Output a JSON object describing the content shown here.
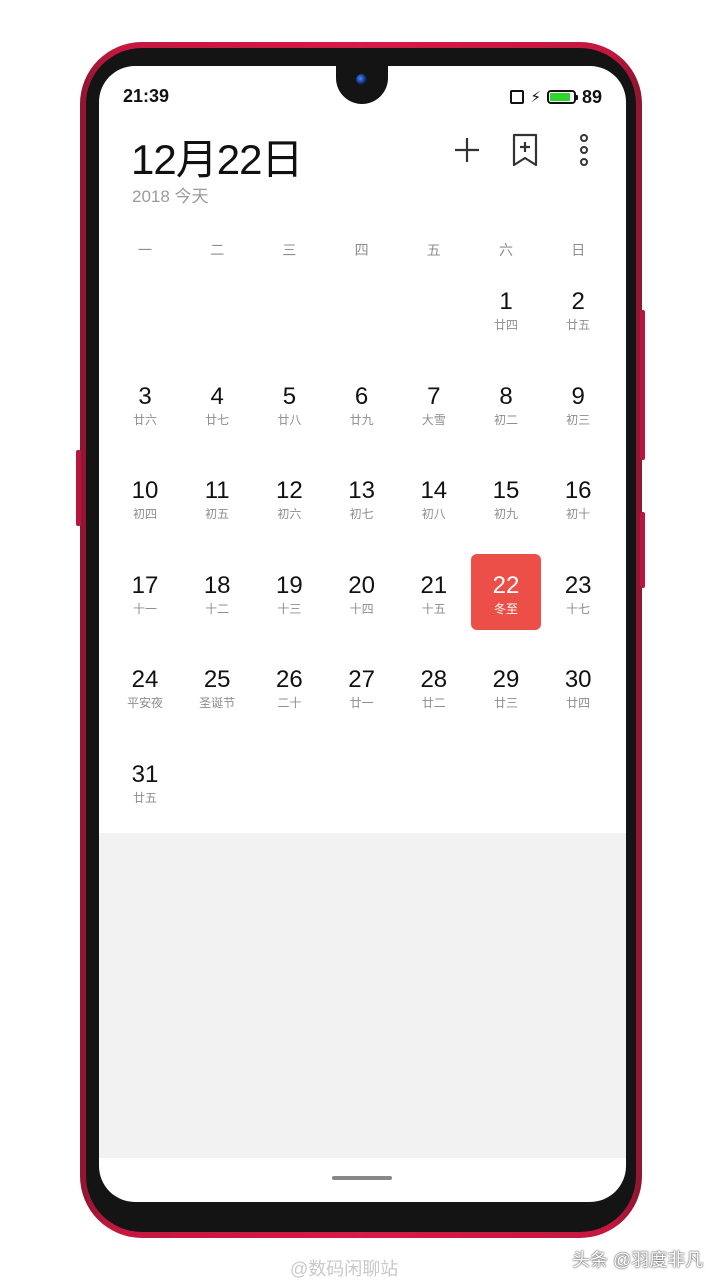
{
  "status_bar": {
    "time": "21:39",
    "battery_percent": "89",
    "battery_level": 0.89,
    "battery_color": "#2fd52f"
  },
  "header": {
    "date_title": "12月22日",
    "subtitle": "2018 今天"
  },
  "icons": {
    "add": "plus-icon",
    "bookmark": "bookmark-add-icon",
    "more": "more-vertical-icon"
  },
  "weekdays": [
    "一",
    "二",
    "三",
    "四",
    "五",
    "六",
    "日"
  ],
  "days": [
    {
      "num": "1",
      "lunar": "廿四"
    },
    {
      "num": "2",
      "lunar": "廿五"
    },
    {
      "num": "3",
      "lunar": "廿六"
    },
    {
      "num": "4",
      "lunar": "廿七"
    },
    {
      "num": "5",
      "lunar": "廿八"
    },
    {
      "num": "6",
      "lunar": "廿九"
    },
    {
      "num": "7",
      "lunar": "大雪"
    },
    {
      "num": "8",
      "lunar": "初二"
    },
    {
      "num": "9",
      "lunar": "初三"
    },
    {
      "num": "10",
      "lunar": "初四"
    },
    {
      "num": "11",
      "lunar": "初五"
    },
    {
      "num": "12",
      "lunar": "初六"
    },
    {
      "num": "13",
      "lunar": "初七"
    },
    {
      "num": "14",
      "lunar": "初八"
    },
    {
      "num": "15",
      "lunar": "初九"
    },
    {
      "num": "16",
      "lunar": "初十"
    },
    {
      "num": "17",
      "lunar": "十一"
    },
    {
      "num": "18",
      "lunar": "十二"
    },
    {
      "num": "19",
      "lunar": "十三"
    },
    {
      "num": "20",
      "lunar": "十四"
    },
    {
      "num": "21",
      "lunar": "十五"
    },
    {
      "num": "22",
      "lunar": "冬至"
    },
    {
      "num": "23",
      "lunar": "十七"
    },
    {
      "num": "24",
      "lunar": "平安夜"
    },
    {
      "num": "25",
      "lunar": "圣诞节"
    },
    {
      "num": "26",
      "lunar": "二十"
    },
    {
      "num": "27",
      "lunar": "廿一"
    },
    {
      "num": "28",
      "lunar": "廿二"
    },
    {
      "num": "29",
      "lunar": "廿三"
    },
    {
      "num": "30",
      "lunar": "廿四"
    },
    {
      "num": "31",
      "lunar": "廿五"
    }
  ],
  "selected_day": "22",
  "colors": {
    "selected": "#ec4e48",
    "frame": "#d71a47"
  },
  "watermarks": {
    "weibo": "@数码闲聊站",
    "toutiao": "头条 @羽度非凡"
  }
}
